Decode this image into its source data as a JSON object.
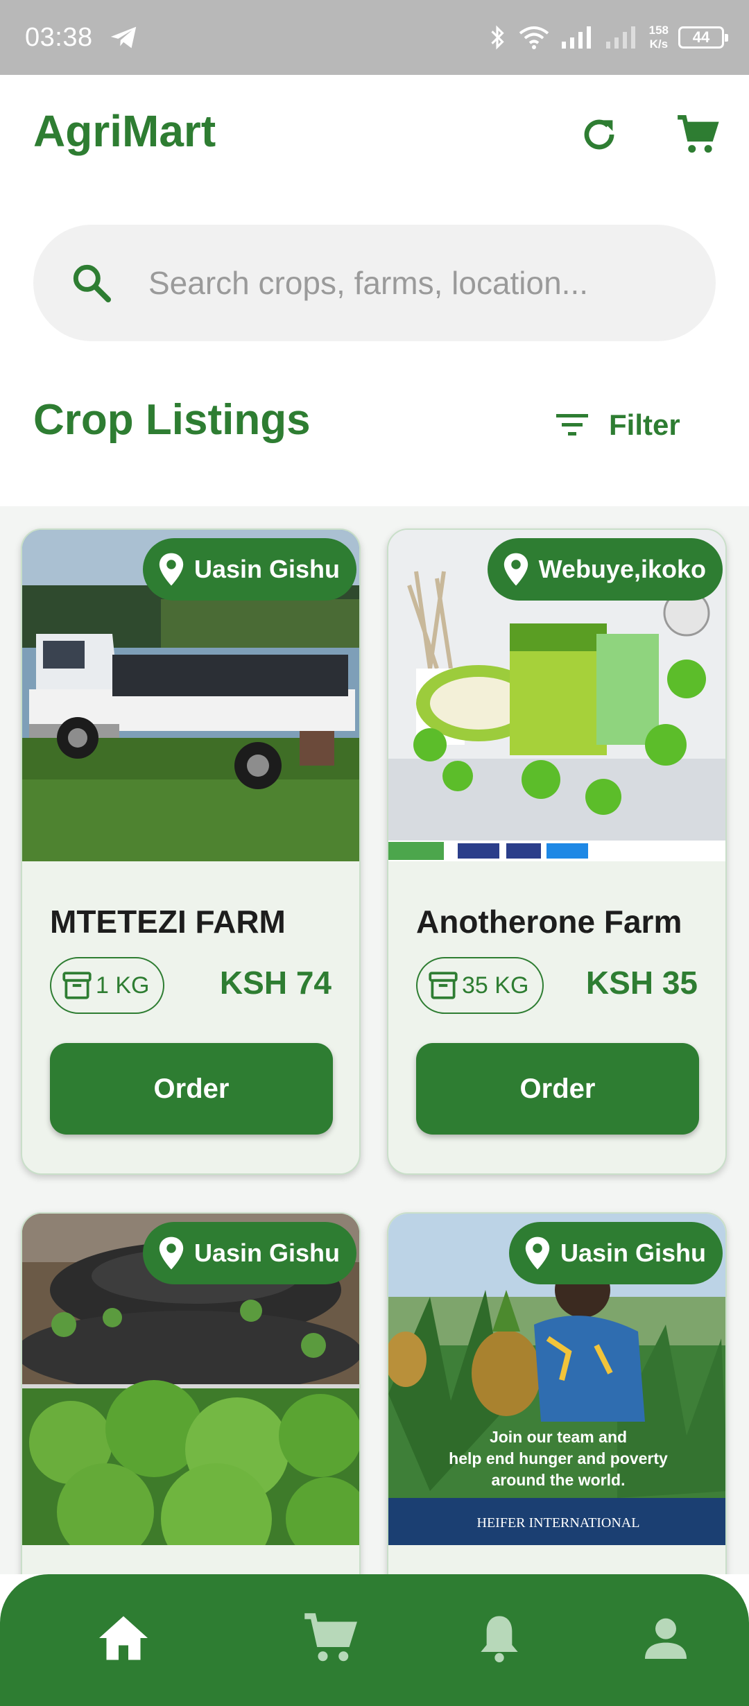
{
  "status_bar": {
    "time": "03:38",
    "speed_value": "158",
    "speed_unit": "K/s",
    "battery": "44"
  },
  "app": {
    "title": "AgriMart",
    "refresh_icon": "refresh-icon",
    "cart_icon": "cart-icon"
  },
  "search": {
    "placeholder": "Search crops, farms, location..."
  },
  "section": {
    "title": "Crop Listings",
    "filter_label": "Filter"
  },
  "listings": [
    {
      "location": "Uasin Gishu",
      "farm": "MTETEZI FARM",
      "quantity": "1 KG",
      "price": "KSH 74",
      "order_label": "Order",
      "image": "white pickup truck on grass"
    },
    {
      "location": "Webuye,ikoko",
      "farm": "Anotherone Farm",
      "quantity": "35 KG",
      "price": "KSH 35",
      "order_label": "Order",
      "image": "green papaya soap product box"
    },
    {
      "location": "Uasin Gishu",
      "image": "vegetable garden with spinach"
    },
    {
      "location": "Uasin Gishu",
      "image": "woman harvesting pineapples",
      "image_text": [
        "Join our team and",
        "help end hunger and poverty",
        "around the world."
      ],
      "image_brand": "HEIFER INTERNATIONAL"
    }
  ],
  "bottom_nav": [
    "home-icon",
    "cart-icon",
    "bell-icon",
    "person-icon"
  ],
  "colors": {
    "primary": "#2e7d32",
    "card_bg": "#eef3ec",
    "status_bar": "#b8b8b8"
  }
}
